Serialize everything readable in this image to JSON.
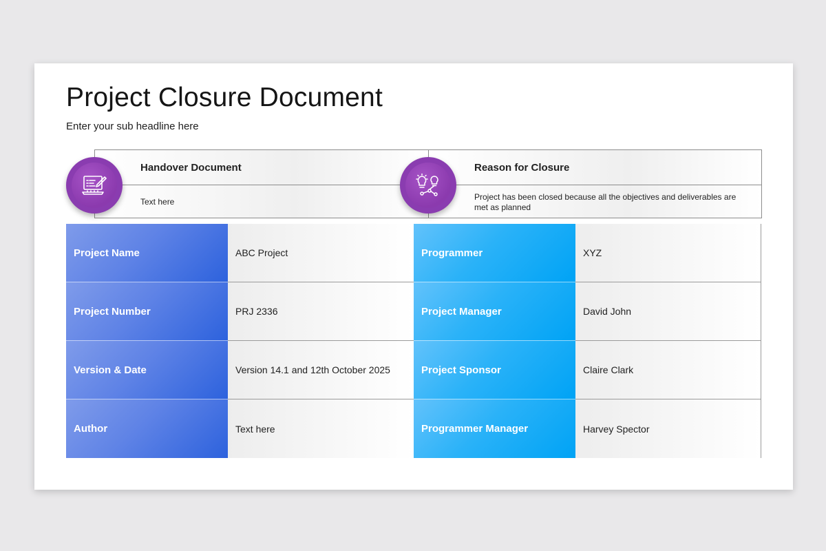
{
  "title": "Project Closure Document",
  "subtitle": "Enter your sub headline here",
  "sections": [
    {
      "heading": "Handover Document",
      "text": "Text here",
      "icon": "computer-checklist-icon"
    },
    {
      "heading": "Reason for Closure",
      "text": "Project has been closed because all the objectives and deliverables are met as planned",
      "icon": "idea-network-icon"
    }
  ],
  "left_table": [
    {
      "label": "Project Name",
      "value": "ABC Project"
    },
    {
      "label": "Project Number",
      "value": "PRJ 2336"
    },
    {
      "label": "Version & Date",
      "value": "Version 14.1 and 12th October 2025"
    },
    {
      "label": "Author",
      "value": "Text here"
    }
  ],
  "right_table": [
    {
      "label": "Programmer",
      "value": "XYZ"
    },
    {
      "label": "Project Manager",
      "value": "David John"
    },
    {
      "label": "Project Sponsor",
      "value": "Claire Clark"
    },
    {
      "label": "Programmer Manager",
      "value": "Harvey Spector"
    }
  ],
  "colors": {
    "accent_purple": "#8a3cb0",
    "blue_label": "#2d62dd",
    "cyan_label": "#00a3f5",
    "background": "#e9e8ea"
  }
}
